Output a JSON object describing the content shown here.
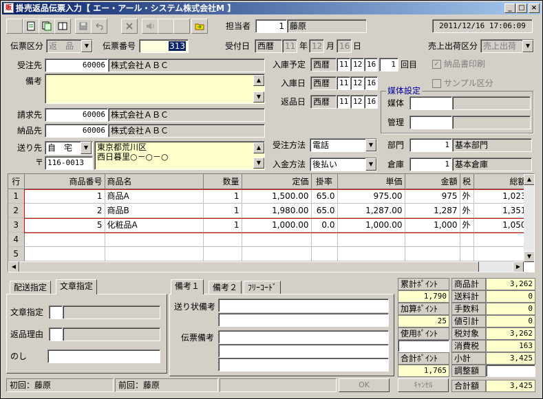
{
  "window": {
    "title": "掛売返品伝票入力【 エー・アール・システム株式会社M 】",
    "app_icon": "販",
    "controls": [
      "_",
      "□",
      "×"
    ]
  },
  "toolbar": {
    "icons": [
      "blank-icon",
      "new-doc-icon",
      "copy-doc-icon",
      "book-icon",
      "save-icon",
      "undo-icon",
      "delete-icon",
      "speaker-icon",
      "blank-icon",
      "folder-icon"
    ],
    "tanto_label": "担当者",
    "tanto_code": "1",
    "tanto_name": "藤原",
    "datetime": "2011/12/16 17:06:09"
  },
  "header": {
    "denpyo_kubun_label": "伝票区分",
    "denpyo_kubun_value": "返　品",
    "denpyo_no_label": "伝票番号",
    "denpyo_no_value": "313",
    "uketsuke_label": "受付日",
    "era": "西暦",
    "year": "11",
    "year_unit": "年",
    "month": "12",
    "month_unit": "月",
    "day": "16",
    "day_unit": "日",
    "uriage_kubun_label": "売上出荷区分",
    "uriage_kubun_value": "売上出荷"
  },
  "customer": {
    "juchusaki_label": "受注先",
    "juchusaki_code": "60006",
    "juchusaki_name": "株式会社ＡＢＣ",
    "biko_label": "備考",
    "seikyusaki_label": "請求先",
    "seikyusaki_code": "60006",
    "seikyusaki_name": "株式会社ＡＢＣ",
    "nohinsaki_label": "納品先",
    "nohinsaki_code": "60006",
    "nohinsaki_name": "株式会社ＡＢＣ",
    "okurisaki_label": "送り先",
    "okurisaki_value": "自　宅",
    "zip_label": "〒",
    "zip_value": "116-0013",
    "address1": "東京都荒川区",
    "address2": "西日暮里○－○－○"
  },
  "dates": {
    "nyuko_yotei_label": "入庫予定",
    "nyuko_yotei": [
      "西暦",
      "11",
      "12",
      "16"
    ],
    "kaime_value": "1",
    "kaime_label": "回目",
    "nyukobi_label": "入庫日",
    "nyukobi": [
      "西暦",
      "11",
      "12",
      "16"
    ],
    "henpinbi_label": "返品日",
    "henpinbi": [
      "西暦",
      "11",
      "12",
      "16"
    ],
    "nohinsho_label": "納品書印刷",
    "sample_label": "サンプル区分",
    "baitai_group_label": "媒体設定",
    "baitai_label": "媒体",
    "kanri_label": "管理",
    "juchu_hoho_label": "受注方法",
    "juchu_hoho_value": "電話",
    "nyukin_hoho_label": "入金方法",
    "nyukin_hoho_value": "後払い",
    "bumon_label": "部門",
    "bumon_code": "1",
    "bumon_name": "基本部門",
    "soko_label": "倉庫",
    "soko_code": "1",
    "soko_name": "基本倉庫"
  },
  "grid": {
    "columns": [
      "行",
      "商品番号",
      "商品名",
      "数量",
      "定価",
      "掛率",
      "単価",
      "金額",
      "税",
      "総額"
    ],
    "rows": [
      [
        "1",
        "1",
        "商品A",
        "1",
        "1,500.00",
        "65.0",
        "975.00",
        "975",
        "外",
        "1,023"
      ],
      [
        "2",
        "2",
        "商品B",
        "1",
        "1,980.00",
        "65.0",
        "1,287.00",
        "1,287",
        "外",
        "1,351"
      ],
      [
        "3",
        "5",
        "化粧品A",
        "1",
        "1,000.00",
        "0.0",
        "1,000.00",
        "1,000",
        "外",
        "1,050"
      ],
      [
        "4",
        "",
        "",
        "",
        "",
        "",
        "",
        "",
        "",
        ""
      ],
      [
        "5",
        "",
        "",
        "",
        "",
        "",
        "",
        "",
        "",
        ""
      ]
    ]
  },
  "tabs_left": {
    "tabs": [
      "配送指定",
      "文章指定"
    ],
    "bunsho_label": "文章指定",
    "henpin_riyu_label": "返品理由",
    "noshi_label": "のし"
  },
  "tabs_mid": {
    "tabs": [
      "備考１",
      "備考２",
      "ﾌﾘｰｺｰﾄﾞ"
    ],
    "okurijo_label": "送り状備考",
    "denpyo_biko_label": "伝票備考"
  },
  "points": {
    "ruikei_label": "累計ﾎﾟｲﾝﾄ",
    "ruikei_value": "1,790",
    "kasan_label": "加算ﾎﾟｲﾝﾄ",
    "kasan_value": "25",
    "shiyo_label": "使用ﾎﾟｲﾝﾄ",
    "shiyo_value": "",
    "gokei_label": "合計ﾎﾟｲﾝﾄ",
    "gokei_value": "1,765"
  },
  "totals": {
    "rows": [
      {
        "label": "商品計",
        "value": "3,262"
      },
      {
        "label": "送料計",
        "value": "0"
      },
      {
        "label": "手数料",
        "value": "0"
      },
      {
        "label": "値引計",
        "value": "0"
      },
      {
        "label": "税対象",
        "value": "3,262"
      },
      {
        "label": "消費税",
        "value": "163"
      },
      {
        "label": "小計",
        "value": "3,425"
      },
      {
        "label": "調整額",
        "value": ""
      },
      {
        "label": "合計額",
        "value": "3,425"
      }
    ]
  },
  "buttons": {
    "ok": "OK",
    "cancel": "ｷｬﾝｾﾙ"
  },
  "statusbar": {
    "first": "初回：藤原",
    "prev": "前回：藤原"
  }
}
